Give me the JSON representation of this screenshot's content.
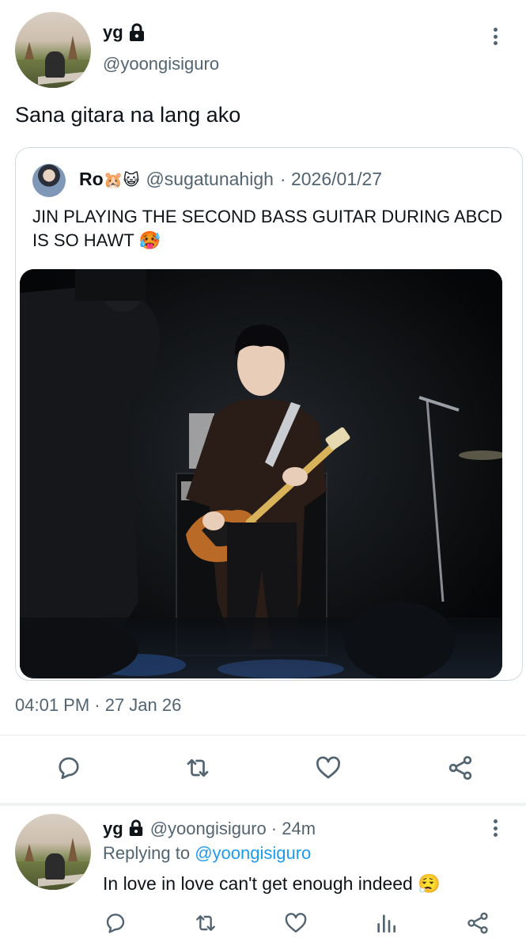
{
  "tweet": {
    "author": {
      "display_name": "yg",
      "handle": "@yoongisiguro",
      "protected": true
    },
    "text": "Sana gitara na lang ako",
    "timestamp": "04:01 PM · 27 Jan 26",
    "quoted": {
      "display_name": "Ro",
      "name_emojis": "🐹😺",
      "handle": "@sugatunahigh",
      "date": "· 2026/01/27",
      "text": "JIN PLAYING THE SECOND BASS GUITAR DURING ABCD IS SO HAWT 🥵"
    },
    "actions": {
      "reply_icon": "reply-icon",
      "retweet_icon": "retweet-icon",
      "like_icon": "heart-icon",
      "share_icon": "share-icon"
    }
  },
  "reply": {
    "author": {
      "display_name": "yg",
      "handle": "@yoongisiguro",
      "protected": true
    },
    "time": "· 24m",
    "replying_to_prefix": "Replying to",
    "replying_to_handle": "@yoongisiguro",
    "text": "In love in love can't get enough indeed 😮‍💨"
  },
  "colors": {
    "text_primary": "#0f1419",
    "text_secondary": "#536471",
    "accent": "#1d9bf0",
    "border": "#cfd9de"
  }
}
